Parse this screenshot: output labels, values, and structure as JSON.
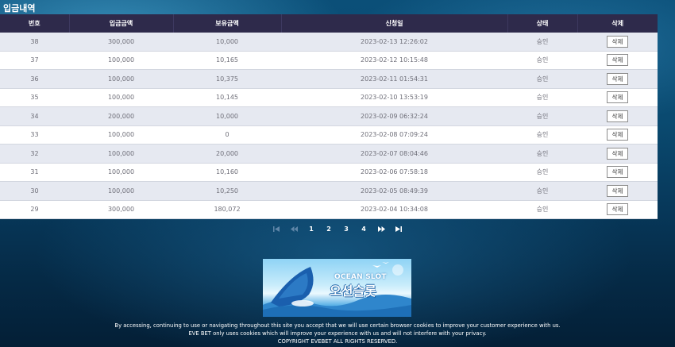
{
  "page_title": "입금내역",
  "table": {
    "headers": [
      "번호",
      "입금금액",
      "보유금액",
      "신청일",
      "상태",
      "삭제"
    ],
    "rows": [
      {
        "no": "38",
        "deposit": "300,000",
        "balance": "10,000",
        "date": "2023-02-13 12:26:02",
        "status": "승인",
        "action": "삭제"
      },
      {
        "no": "37",
        "deposit": "100,000",
        "balance": "10,165",
        "date": "2023-02-12 10:15:48",
        "status": "승인",
        "action": "삭제"
      },
      {
        "no": "36",
        "deposit": "100,000",
        "balance": "10,375",
        "date": "2023-02-11 01:54:31",
        "status": "승인",
        "action": "삭제"
      },
      {
        "no": "35",
        "deposit": "100,000",
        "balance": "10,145",
        "date": "2023-02-10 13:53:19",
        "status": "승인",
        "action": "삭제"
      },
      {
        "no": "34",
        "deposit": "200,000",
        "balance": "10,000",
        "date": "2023-02-09 06:32:24",
        "status": "승인",
        "action": "삭제"
      },
      {
        "no": "33",
        "deposit": "100,000",
        "balance": "0",
        "date": "2023-02-08 07:09:24",
        "status": "승인",
        "action": "삭제"
      },
      {
        "no": "32",
        "deposit": "100,000",
        "balance": "20,000",
        "date": "2023-02-07 08:04:46",
        "status": "승인",
        "action": "삭제"
      },
      {
        "no": "31",
        "deposit": "100,000",
        "balance": "10,160",
        "date": "2023-02-06 07:58:18",
        "status": "승인",
        "action": "삭제"
      },
      {
        "no": "30",
        "deposit": "100,000",
        "balance": "10,250",
        "date": "2023-02-05 08:49:39",
        "status": "승인",
        "action": "삭제"
      },
      {
        "no": "29",
        "deposit": "300,000",
        "balance": "180,072",
        "date": "2023-02-04 10:34:08",
        "status": "승인",
        "action": "삭제"
      }
    ]
  },
  "pagination": {
    "pages": [
      "1",
      "2",
      "3",
      "4"
    ],
    "icons": [
      "first-page-icon",
      "prev-page-icon",
      "next-page-icon",
      "last-page-icon"
    ]
  },
  "banner": {
    "title_en": "OCEAN SLOT",
    "title_ko": "오션슬롯"
  },
  "footer": {
    "line1": "By accessing, continuing to use or navigating throughout this site you accept that we will use certain browser cookies to improve your customer experience with us.",
    "line2": "EVE BET only uses cookies which will improve your experience with us and will not interfere with your privacy.",
    "line3": "COPYRIGHT EVEBET ALL RIGHTS RESERVED."
  },
  "colors": {
    "header_bg": "#2e2a4b",
    "row_odd": "#e6e9f1",
    "row_even": "#ffffff",
    "page_bg": "#0a4a70"
  }
}
